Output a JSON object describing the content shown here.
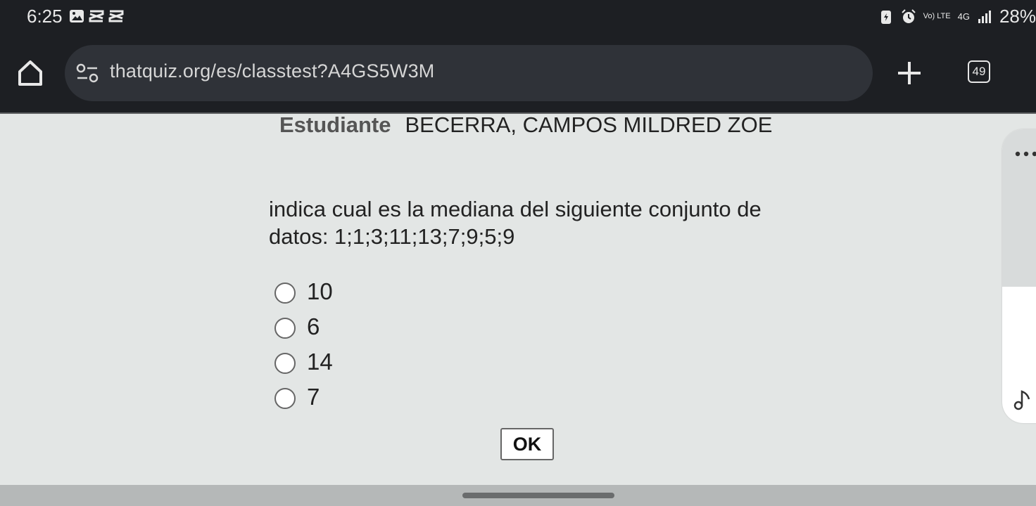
{
  "status_bar": {
    "time": "6:25",
    "battery": "28%",
    "network_volte": "Vo) LTE",
    "network_4g": "4G"
  },
  "browser": {
    "url": "thatquiz.org/es/classtest?A4GS5W3M",
    "tab_count": "49"
  },
  "page": {
    "student_label": "Estudiante",
    "student_name": "BECERRA, CAMPOS MILDRED ZOE",
    "question": "indica cual es la mediana del siguiente conjunto de datos: 1;1;3;11;13;7;9;5;9",
    "options": [
      "10",
      "6",
      "14",
      "7"
    ],
    "ok_label": "OK"
  },
  "colors": {
    "topbar": "#1d1f23",
    "urlbar": "#2f3238",
    "page_background": "#e3e6e5"
  }
}
